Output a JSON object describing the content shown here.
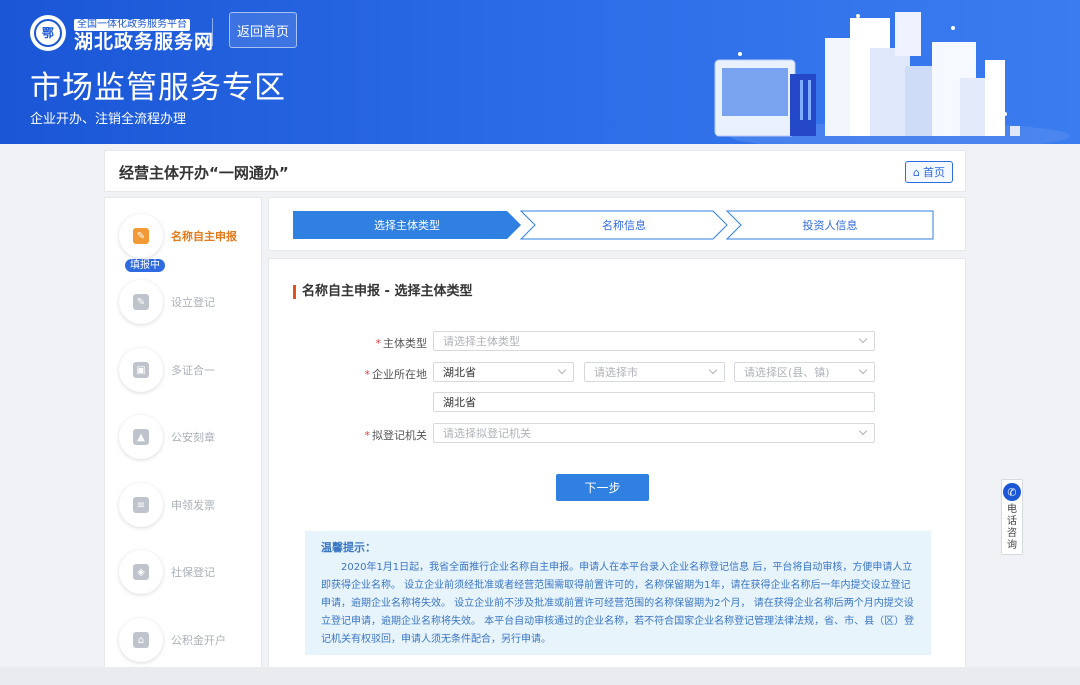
{
  "header": {
    "logo_tag": "全国一体化政务服务平台",
    "logo_title": "湖北政务服务网",
    "home_button": "返回首页",
    "zone_title": "市场监管服务专区",
    "zone_subtitle": "企业开办、注销全流程办理"
  },
  "card": {
    "title": "经营主体开办“一网通办”",
    "home_link": "首页"
  },
  "sidebar": {
    "filling_badge": "填报中",
    "items": [
      {
        "label": "名称自主申报",
        "icon": "edit-icon"
      },
      {
        "label": "设立登记",
        "icon": "register-icon"
      },
      {
        "label": "多证合一",
        "icon": "certificate-icon"
      },
      {
        "label": "公安刻章",
        "icon": "seal-icon"
      },
      {
        "label": "申领发票",
        "icon": "invoice-icon"
      },
      {
        "label": "社保登记",
        "icon": "shield-icon"
      },
      {
        "label": "公积金开户",
        "icon": "house-icon"
      }
    ]
  },
  "steps": [
    {
      "label": "选择主体类型"
    },
    {
      "label": "名称信息"
    },
    {
      "label": "投资人信息"
    }
  ],
  "form": {
    "section_title": "名称自主申报 - 选择主体类型",
    "entity_type_label": "主体类型",
    "entity_type_placeholder": "请选择主体类型",
    "location_label": "企业所在地",
    "province_value": "湖北省",
    "city_placeholder": "请选择市",
    "district_placeholder": "请选择区(县、镇)",
    "address_value": "湖北省",
    "authority_label": "拟登记机关",
    "authority_placeholder": "请选择拟登记机关",
    "next_button": "下一步"
  },
  "tips": {
    "title": "温馨提示：",
    "body": "2020年1月1日起，我省全面推行企业名称自主申报。申请人在本平台录入企业名称登记信息 后，平台将自动审核，方便申请人立即获得企业名称。 设立企业前须经批准或者经营范围需取得前置许可的，名称保留期为1年，请在获得企业名称后一年内提交设立登记申请，逾期企业名称将失效。 设立企业前不涉及批准或前置许可经营范围的名称保留期为2个月， 请在获得企业名称后两个月内提交设立登记申请，逾期企业名称将失效。 本平台自动审核通过的企业名称，若不符合国家企业名称登记管理法律法规，省、市、县（区）登记机关有权驳回，申请人须无条件配合，另行申请。"
  },
  "side_widget": {
    "label": "电话咨询"
  },
  "colors": {
    "brand": "#1a56d6",
    "active_step": "#2f80e0",
    "active_sidebar": "#e07a1a",
    "tips_bg": "#e8f4fc"
  }
}
